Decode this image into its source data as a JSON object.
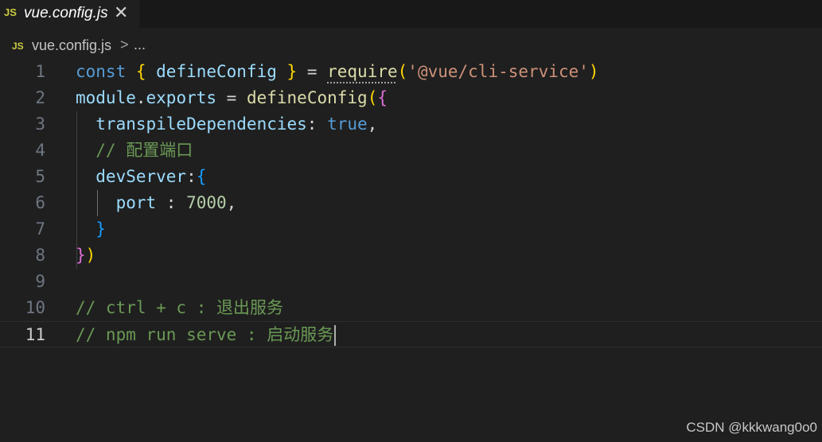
{
  "tab": {
    "badge": "JS",
    "title": "vue.config.js",
    "close": "✕"
  },
  "breadcrumb": {
    "badge": "JS",
    "file": "vue.config.js",
    "separator": ">",
    "more": "..."
  },
  "editor": {
    "lines": [
      {
        "n": "1",
        "tokens": [
          [
            "const ",
            "k-blue"
          ],
          [
            "{ ",
            "b1"
          ],
          [
            "defineConfig ",
            "k-var"
          ],
          [
            "} ",
            "b1"
          ],
          [
            "= ",
            "k-op"
          ],
          [
            "require",
            "k-fn squiggle"
          ],
          [
            "(",
            "b1"
          ],
          [
            "'@vue/cli-service'",
            "k-str"
          ],
          [
            ")",
            "b1"
          ]
        ]
      },
      {
        "n": "2",
        "tokens": [
          [
            "module",
            "k-var"
          ],
          [
            ".",
            "k-op"
          ],
          [
            "exports",
            "k-var"
          ],
          [
            " = ",
            "k-op"
          ],
          [
            "defineConfig",
            "k-fn"
          ],
          [
            "(",
            "b1"
          ],
          [
            "{",
            "b2"
          ]
        ]
      },
      {
        "n": "3",
        "tokens": [
          [
            "  transpileDependencies",
            "k-var"
          ],
          [
            ": ",
            "k-op"
          ],
          [
            "true",
            "k-blue"
          ],
          [
            ",",
            "k-op"
          ]
        ]
      },
      {
        "n": "4",
        "tokens": [
          [
            "  // 配置端口",
            "k-com"
          ]
        ]
      },
      {
        "n": "5",
        "tokens": [
          [
            "  devServer",
            "k-var"
          ],
          [
            ":",
            "k-op"
          ],
          [
            "{",
            "b3"
          ]
        ]
      },
      {
        "n": "6",
        "tokens": [
          [
            "    port",
            "k-var"
          ],
          [
            " : ",
            "k-op"
          ],
          [
            "7000",
            "k-num"
          ],
          [
            ",",
            "k-op"
          ]
        ]
      },
      {
        "n": "7",
        "tokens": [
          [
            "  ",
            "k-op"
          ],
          [
            "}",
            "b3"
          ]
        ]
      },
      {
        "n": "8",
        "tokens": [
          [
            "}",
            "b2"
          ],
          [
            ")",
            "b1"
          ]
        ]
      },
      {
        "n": "9",
        "tokens": []
      },
      {
        "n": "10",
        "tokens": [
          [
            "// ctrl + c : 退出服务",
            "k-com"
          ]
        ]
      },
      {
        "n": "11",
        "tokens": [
          [
            "// npm run serve : 启动服务",
            "k-com"
          ]
        ]
      }
    ],
    "active_line": "11"
  },
  "watermark": "CSDN @kkkwang0o0",
  "colors": {
    "background": "#1f1f1f",
    "tabbar": "#181818",
    "js_badge": "#cbcb41"
  }
}
